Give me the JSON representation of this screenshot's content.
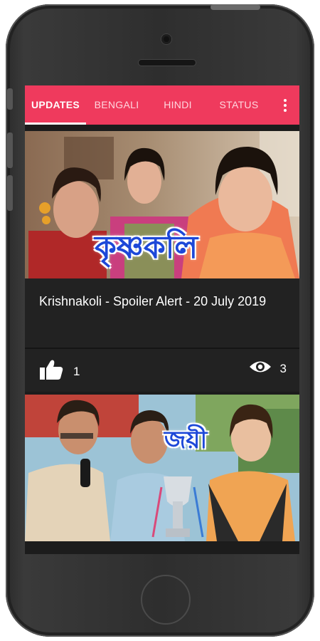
{
  "tabs": [
    {
      "label": "UPDATES",
      "active": true
    },
    {
      "label": "BENGALI",
      "active": false
    },
    {
      "label": "HINDI",
      "active": false
    },
    {
      "label": "STATUS",
      "active": false
    }
  ],
  "colors": {
    "accent": "#ef3a5d",
    "card": "#222222",
    "screen": "#1c1c1c"
  },
  "cards": [
    {
      "thumbnail_text": "কৃষ্ণকলি",
      "title": "Krishnakoli - Spoiler Alert - 20 July 2019",
      "likes": "1",
      "views": "3",
      "like_icon": "thumbs-up-icon",
      "view_icon": "eye-icon"
    },
    {
      "thumbnail_text": "জয়ী"
    }
  ],
  "menu_icon": "more-vert-icon"
}
